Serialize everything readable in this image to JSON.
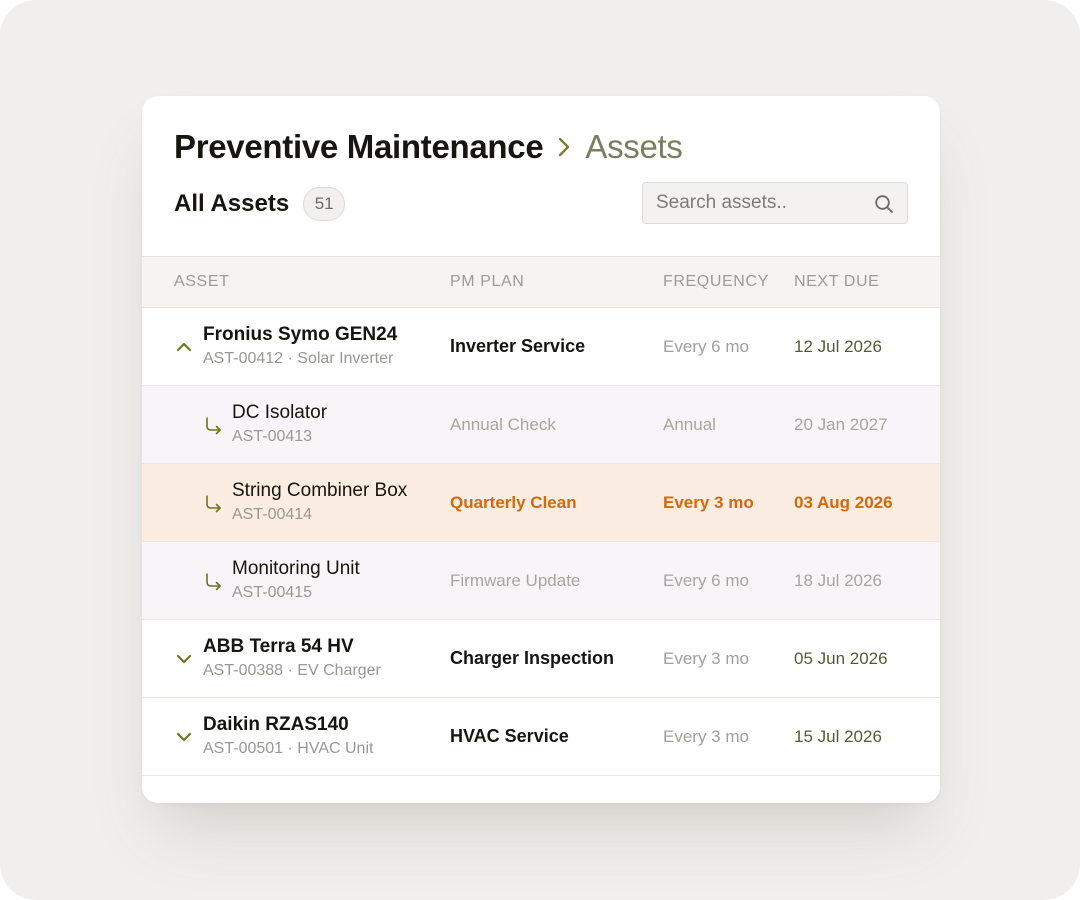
{
  "header": {
    "title": "Preventive Maintenance",
    "breadcrumb_current": "Assets"
  },
  "toolbar": {
    "all_assets_label": "All Assets",
    "count": "51",
    "search_placeholder": "Search assets.."
  },
  "table": {
    "columns": [
      "ASSET",
      "PM PLAN",
      "FREQUENCY",
      "NEXT DUE"
    ],
    "rows": [
      {
        "name": "Fronius Symo GEN24",
        "sub": "AST-00412 · Solar Inverter",
        "plan": "Inverter Service",
        "frequency": "Every 6 mo",
        "next_due": "12 Jul 2026",
        "kind": "parent",
        "expanded": true
      },
      {
        "name": "DC Isolator",
        "sub": "AST-00413",
        "plan": "Annual Check",
        "frequency": "Annual",
        "next_due": "20 Jan 2027",
        "kind": "child"
      },
      {
        "name": "String Combiner Box",
        "sub": "AST-00414",
        "plan": "Quarterly Clean",
        "frequency": "Every 3 mo",
        "next_due": "03 Aug 2026",
        "kind": "child",
        "highlighted": true
      },
      {
        "name": "Monitoring Unit",
        "sub": "AST-00415",
        "plan": "Firmware Update",
        "frequency": "Every 6 mo",
        "next_due": "18 Jul 2026",
        "kind": "child"
      },
      {
        "name": "ABB Terra 54 HV",
        "sub": "AST-00388 · EV Charger",
        "plan": "Charger Inspection",
        "frequency": "Every 3 mo",
        "next_due": "05 Jun 2026",
        "kind": "parent",
        "expanded": false
      },
      {
        "name": "Daikin RZAS140",
        "sub": "AST-00501 · HVAC Unit",
        "plan": "HVAC Service",
        "frequency": "Every 3 mo",
        "next_due": "15 Jul 2026",
        "kind": "parent",
        "expanded": false
      }
    ]
  },
  "icons": {
    "breadcrumb_separator": "chevron-right-icon",
    "search": "search-icon",
    "expanded_toggle": "chevron-up-icon",
    "collapsed_toggle": "chevron-down-icon",
    "child_indicator": "child-arrow-icon"
  },
  "colors": {
    "accent_olive": "#6e7420",
    "highlight_orange": "#d2690e",
    "highlight_row_bg": "#fbede1",
    "child_row_bg": "#f8f5f8"
  }
}
